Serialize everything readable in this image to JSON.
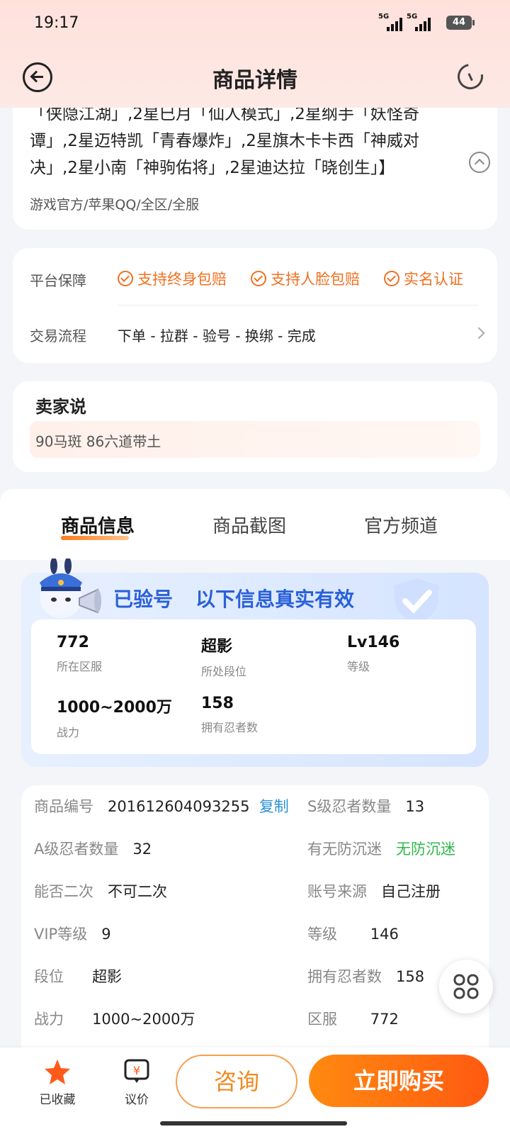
{
  "status_bar": {
    "time": "19:17",
    "net1": "5G",
    "net2": "5G",
    "battery": "44"
  },
  "nav": {
    "title": "商品详情"
  },
  "description": {
    "text": "「侠隐江湖」,2星巳月「仙人模式」,2星纲手「妖怪奇谭」,2星迈特凯「青春爆炸」,2星旗木卡卡西「神威对决」,2星小南「神驹佑将」,2星迪达拉「晓创生」】",
    "meta": "游戏官方/苹果QQ/全区/全服"
  },
  "guarantee": {
    "label": "平台保障",
    "items": [
      "支持终身包赔",
      "支持人脸包赔",
      "实名认证"
    ],
    "process_label": "交易流程",
    "process": "下单 - 拉群 - 验号 - 换绑 - 完成"
  },
  "seller": {
    "title": "卖家说",
    "text": "90马斑 86六道带土"
  },
  "tabs": [
    "商品信息",
    "商品截图",
    "官方频道"
  ],
  "verified": {
    "badge": "已验号",
    "text": "以下信息真实有效",
    "stats": [
      {
        "value": "772",
        "label": "所在区服"
      },
      {
        "value": "超影",
        "label": "所处段位"
      },
      {
        "value": "Lv146",
        "label": "等级"
      },
      {
        "value": "1000~2000万",
        "label": "战力"
      },
      {
        "value": "158",
        "label": "拥有忍者数"
      }
    ]
  },
  "details": {
    "product_id_label": "商品编号",
    "product_id": "201612604093255",
    "copy_label": "复制",
    "rows": [
      {
        "k": "S级忍者数量",
        "v": "13"
      },
      {
        "k": "A级忍者数量",
        "v": "32"
      },
      {
        "k": "有无防沉迷",
        "v": "无防沉迷"
      },
      {
        "k": "能否二次",
        "v": "不可二次"
      },
      {
        "k": "账号来源",
        "v": "自己注册"
      },
      {
        "k": "VIP等级",
        "v": "9"
      },
      {
        "k": "等级",
        "v": "146"
      },
      {
        "k": "段位",
        "v": "超影"
      },
      {
        "k": "拥有忍者数",
        "v": "158"
      },
      {
        "k": "战力",
        "v": "1000~2000万"
      },
      {
        "k": "区服",
        "v": "772"
      }
    ]
  },
  "bottom": {
    "favorite": "已收藏",
    "bargain": "议价",
    "consult": "咨询",
    "buy": "立即购买"
  },
  "colors": {
    "accent": "#f07020",
    "blue": "#2a60d8",
    "green": "#2fb84a"
  }
}
